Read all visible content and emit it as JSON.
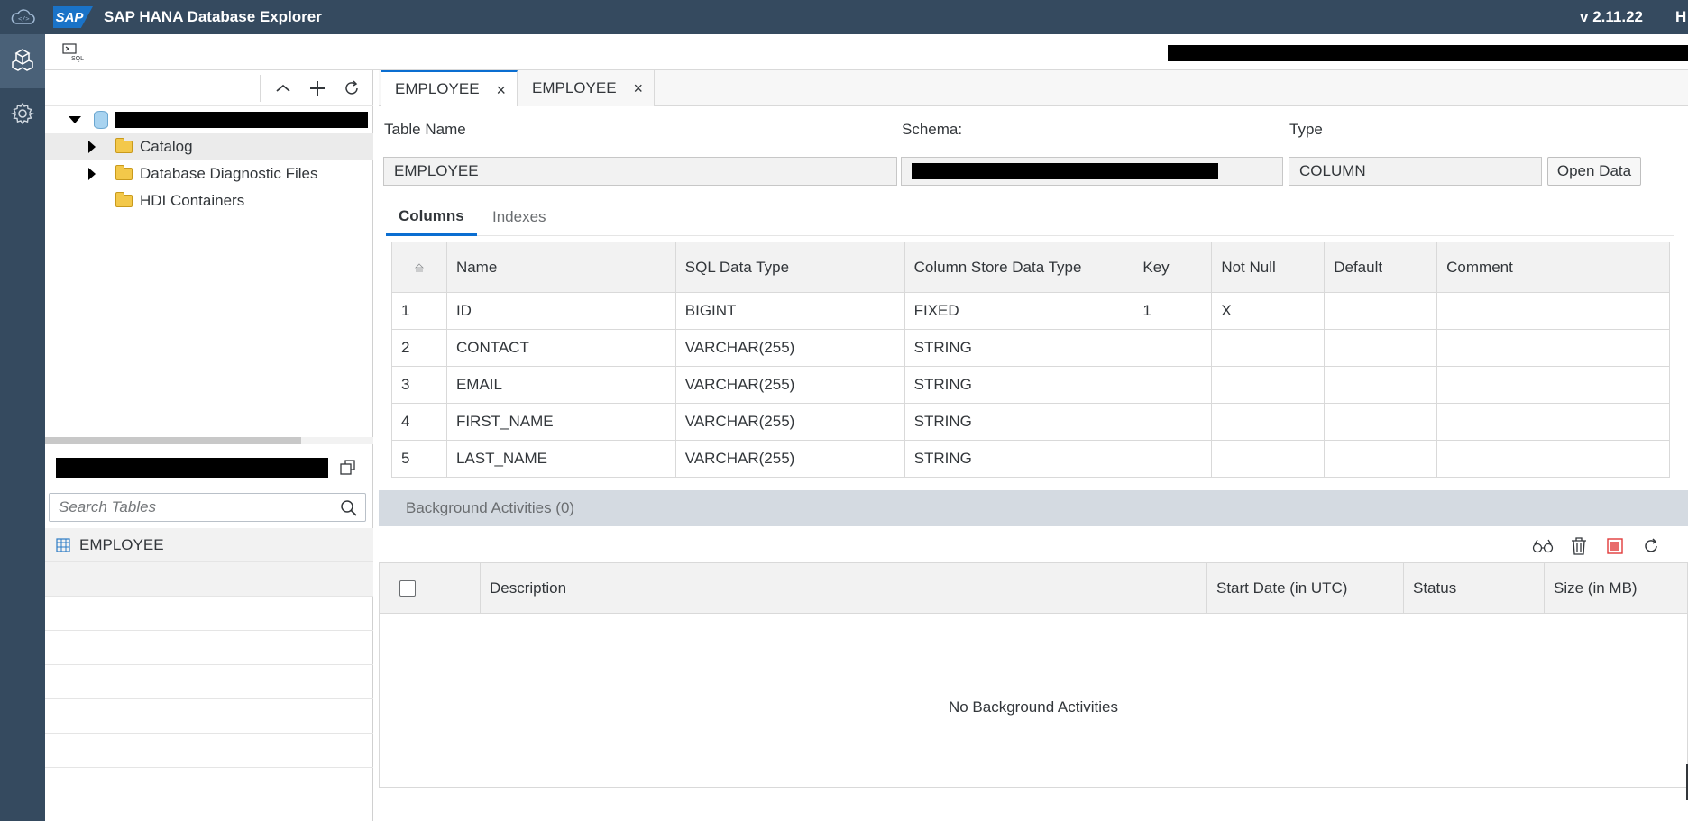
{
  "shell": {
    "title": "SAP HANA Database Explorer",
    "logo_text": "SAP",
    "version": "v 2.11.22",
    "extra": "H"
  },
  "toolbar": {
    "sql_label": "SQL"
  },
  "tree": {
    "root_label": "",
    "items": [
      {
        "label": "Catalog",
        "expandable": true
      },
      {
        "label": "Database Diagnostic Files",
        "expandable": true
      },
      {
        "label": "HDI Containers",
        "expandable": false
      }
    ]
  },
  "search": {
    "placeholder": "Search Tables",
    "value": ""
  },
  "table_list": [
    "EMPLOYEE"
  ],
  "tabs": [
    {
      "label": "EMPLOYEE",
      "close": "×"
    },
    {
      "label": "EMPLOYEE",
      "close": "×"
    }
  ],
  "details": {
    "table_name_label": "Table Name",
    "schema_label": "Schema:",
    "type_label": "Type",
    "table_name_value": "EMPLOYEE",
    "type_value": "COLUMN",
    "open_data_label": "Open Data"
  },
  "subtabs": [
    "Columns",
    "Indexes"
  ],
  "columns_table": {
    "headers": [
      "",
      "Name",
      "SQL Data Type",
      "Column Store Data Type",
      "Key",
      "Not Null",
      "Default",
      "Comment"
    ],
    "rows": [
      [
        "1",
        "ID",
        "BIGINT",
        "FIXED",
        "1",
        "X",
        "",
        ""
      ],
      [
        "2",
        "CONTACT",
        "VARCHAR(255)",
        "STRING",
        "",
        "",
        "",
        ""
      ],
      [
        "3",
        "EMAIL",
        "VARCHAR(255)",
        "STRING",
        "",
        "",
        "",
        ""
      ],
      [
        "4",
        "FIRST_NAME",
        "VARCHAR(255)",
        "STRING",
        "",
        "",
        "",
        ""
      ],
      [
        "5",
        "LAST_NAME",
        "VARCHAR(255)",
        "STRING",
        "",
        "",
        "",
        ""
      ]
    ]
  },
  "background": {
    "title": "Background Activities (0)",
    "headers": [
      "Description",
      "Start Date (in UTC)",
      "Status",
      "Size (in MB)"
    ],
    "empty_message": "No Background Activities"
  },
  "colors": {
    "shell": "#354a5f",
    "accent": "#0a6ed1"
  }
}
